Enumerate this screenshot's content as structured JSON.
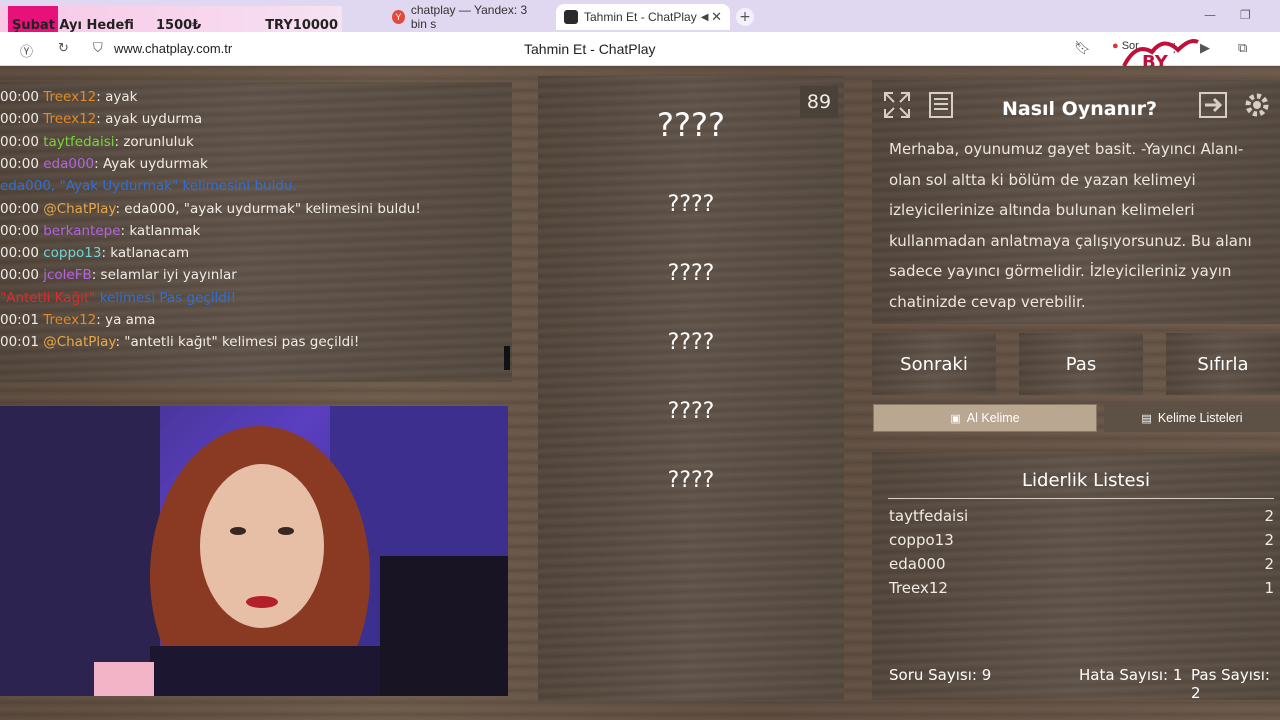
{
  "donation": {
    "goal_label": "Şubat Ayı Hedefi",
    "amount": "1500₺",
    "target": "TRY10000"
  },
  "tabs": [
    {
      "label": "chatplay — Yandex: 3 bin s",
      "icon": "yandex-icon"
    },
    {
      "label": "Tahmin Et - ChatPlay",
      "icon": "chatplay-icon"
    }
  ],
  "address": {
    "url": "www.chatplay.com.tr",
    "page_title": "Tahmin Et - ChatPlay",
    "sor": "Sor"
  },
  "chat": {
    "lines": [
      {
        "ts": "00:00",
        "user": "Treex12",
        "user_color": "#e08a2a",
        "msg": ": ayak"
      },
      {
        "ts": "00:00",
        "user": "Treex12",
        "user_color": "#e08a2a",
        "msg": ": ayak uydurma"
      },
      {
        "ts": "00:00",
        "user": "taytfedaisi",
        "user_color": "#7ad43a",
        "msg": ": zorunluluk"
      },
      {
        "ts": "00:00",
        "user": "eda000",
        "user_color": "#b463e0",
        "msg": ": Ayak uydurmak"
      },
      {
        "ts": "",
        "user": "eda000, \"Ayak Uydurmak\"",
        "user_color": "#2f6fd6",
        "msg": " kelimesini buldu.",
        "msg_color": "#2f6fd6"
      },
      {
        "ts": "00:00",
        "user": "@ChatPlay",
        "user_color": "#e8a84a",
        "msg": ": eda000, \"ayak uydurmak\" kelimesini buldu!"
      },
      {
        "ts": "00:00",
        "user": "berkantepe",
        "user_color": "#b463e0",
        "msg": ": katlanmak"
      },
      {
        "ts": "00:00",
        "user": "coppo13",
        "user_color": "#6bd6d6",
        "msg": ": katlanacam"
      },
      {
        "ts": "00:00",
        "user": "jcoleFB",
        "user_color": "#b463e0",
        "msg": ": selamlar iyi yayınlar"
      },
      {
        "ts": "",
        "user": "\"Antetli Kağıt\"",
        "user_color": "#e02a2a",
        "msg": " kelimesi Pas geçildi!",
        "msg_color": "#2f6fd6"
      },
      {
        "ts": "00:01",
        "user": "Treex12",
        "user_color": "#e08a2a",
        "msg": ": ya ama"
      },
      {
        "ts": "00:01",
        "user": "@ChatPlay",
        "user_color": "#e8a84a",
        "msg": ": \"antetli kağıt\" kelimesi pas geçildi!"
      }
    ]
  },
  "game": {
    "timer": "89",
    "words": [
      "????",
      "????",
      "????",
      "????",
      "????",
      "????"
    ]
  },
  "how_to": {
    "title": "Nasıl Oynanır?",
    "text": "Merhaba, oyunumuz gayet basit. -Yayıncı Alanı- olan sol altta ki bölüm de yazan kelimeyi izleyicilerinize altında bulunan kelimeleri kullanmadan anlatmaya çalışıyorsunuz. Bu alanı sadece yayıncı görmelidir. İzleyicileriniz yayın chatinizde cevap verebilir."
  },
  "controls": {
    "next": "Sonraki",
    "pass": "Pas",
    "reset": "Sıfırla",
    "get_word": "Al Kelime",
    "word_lists": "Kelime Listeleri"
  },
  "leaderboard": {
    "title": "Liderlik Listesi",
    "rows": [
      {
        "name": "taytfedaisi",
        "score": "2"
      },
      {
        "name": "coppo13",
        "score": "2"
      },
      {
        "name": "eda000",
        "score": "2"
      },
      {
        "name": "Treex12",
        "score": "1"
      }
    ],
    "questions_label": "Soru Sayısı: 9",
    "errors_label": "Hata Sayısı: 1",
    "passes_label": "Pas Sayısı: 2"
  }
}
